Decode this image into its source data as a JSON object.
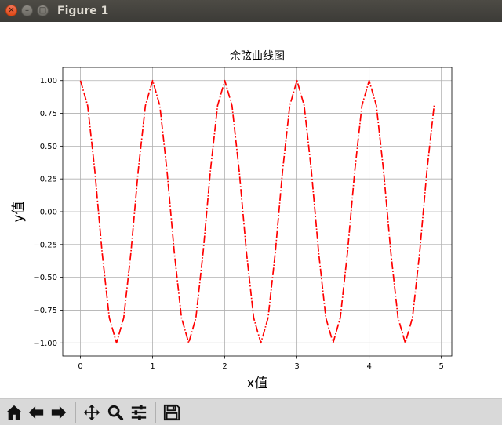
{
  "window": {
    "title": "Figure 1"
  },
  "toolbar": {
    "buttons": [
      {
        "name": "home-button",
        "icon": "home-icon"
      },
      {
        "name": "back-button",
        "icon": "arrow-left-icon"
      },
      {
        "name": "forward-button",
        "icon": "arrow-right-icon"
      },
      {
        "name": "pan-button",
        "icon": "move-icon"
      },
      {
        "name": "zoom-button",
        "icon": "magnifier-icon"
      },
      {
        "name": "configure-subplots-button",
        "icon": "sliders-icon"
      },
      {
        "name": "save-button",
        "icon": "floppy-disk-icon"
      }
    ]
  },
  "chart_data": {
    "type": "line",
    "title": "余弦曲线图",
    "xlabel": "x值",
    "ylabel": "y值",
    "xlim": [
      -0.245,
      5.145
    ],
    "ylim": [
      -1.1,
      1.1
    ],
    "xticks": [
      0,
      1,
      2,
      3,
      4,
      5
    ],
    "xtick_labels": [
      "0",
      "1",
      "2",
      "3",
      "4",
      "5"
    ],
    "yticks": [
      1.0,
      0.75,
      0.5,
      0.25,
      0.0,
      -0.25,
      -0.5,
      -0.75,
      -1.0
    ],
    "ytick_labels": [
      "1.00",
      "0.75",
      "0.50",
      "0.25",
      "0.00",
      "−0.25",
      "−0.50",
      "−0.75",
      "−1.00"
    ],
    "grid": true,
    "series": [
      {
        "color": "#ff0000",
        "linestyle": "dashdot",
        "x": [
          0.0,
          0.1,
          0.2,
          0.3,
          0.4,
          0.5,
          0.6,
          0.7,
          0.8,
          0.9,
          1.0,
          1.1,
          1.2,
          1.3,
          1.4,
          1.5,
          1.6,
          1.7,
          1.8,
          1.9,
          2.0,
          2.1,
          2.2,
          2.3,
          2.4,
          2.5,
          2.6,
          2.7,
          2.8,
          2.9,
          3.0,
          3.1,
          3.2,
          3.3,
          3.4,
          3.5,
          3.6,
          3.7,
          3.8,
          3.9,
          4.0,
          4.1,
          4.2,
          4.3,
          4.4,
          4.5,
          4.6,
          4.7,
          4.8,
          4.9
        ],
        "y": [
          1.0,
          0.809,
          0.309,
          -0.309,
          -0.809,
          -1.0,
          -0.809,
          -0.309,
          0.309,
          0.809,
          1.0,
          0.809,
          0.309,
          -0.309,
          -0.809,
          -1.0,
          -0.809,
          -0.309,
          0.309,
          0.809,
          1.0,
          0.809,
          0.309,
          -0.309,
          -0.809,
          -1.0,
          -0.809,
          -0.309,
          0.309,
          0.809,
          1.0,
          0.809,
          0.309,
          -0.309,
          -0.809,
          -1.0,
          -0.809,
          -0.309,
          0.309,
          0.809,
          1.0,
          0.809,
          0.309,
          -0.309,
          -0.809,
          -1.0,
          -0.809,
          -0.309,
          0.309,
          0.809
        ]
      }
    ]
  }
}
